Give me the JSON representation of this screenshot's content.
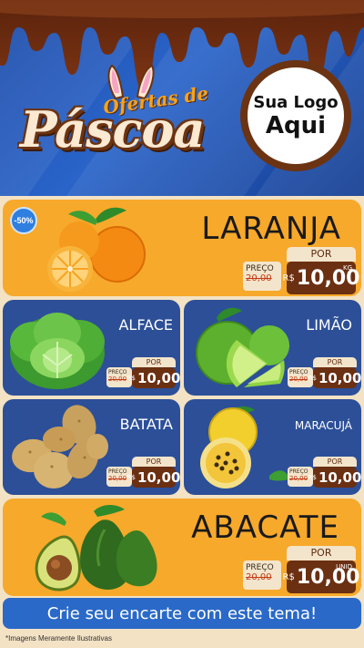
{
  "header": {
    "subtitle": "Ofertas de",
    "title": "Páscoa",
    "logo_line1": "Sua Logo",
    "logo_line2": "Aqui"
  },
  "colors": {
    "blue": "#2c4f98",
    "orange": "#f7a92b",
    "chocolate": "#6b2f12",
    "cream": "#f3e5cc",
    "banner": "#2a69c8"
  },
  "products": [
    {
      "name": "LARANJA",
      "badge": "-50%",
      "por": "POR",
      "preco": "PREÇO",
      "old": "20,00",
      "currency": "R$",
      "price": "10,00",
      "unit": "KG",
      "icon": "orange-icon"
    },
    {
      "name": "ALFACE",
      "por": "POR",
      "preco": "PREÇO",
      "old": "20,00",
      "currency": "R$",
      "price": "10,00",
      "icon": "lettuce-icon"
    },
    {
      "name": "LIMÃO",
      "por": "POR",
      "preco": "PREÇO",
      "old": "20,00",
      "currency": "R$",
      "price": "10,00",
      "icon": "lime-icon"
    },
    {
      "name": "BATATA",
      "por": "POR",
      "preco": "PREÇO",
      "old": "20,00",
      "currency": "R$",
      "price": "10,00",
      "icon": "potato-icon"
    },
    {
      "name": "MARACUJÁ",
      "por": "POR",
      "preco": "PREÇO",
      "old": "20,00",
      "currency": "R$",
      "price": "10,00",
      "icon": "passion-fruit-icon"
    },
    {
      "name": "ABACATE",
      "por": "POR",
      "preco": "PREÇO",
      "old": "20,00",
      "currency": "R$",
      "price": "10,00",
      "unit": "UNID",
      "icon": "avocado-icon"
    }
  ],
  "banner": "Crie seu encarte com este tema!",
  "footnote": "*Imagens Meramente Ilustrativas"
}
